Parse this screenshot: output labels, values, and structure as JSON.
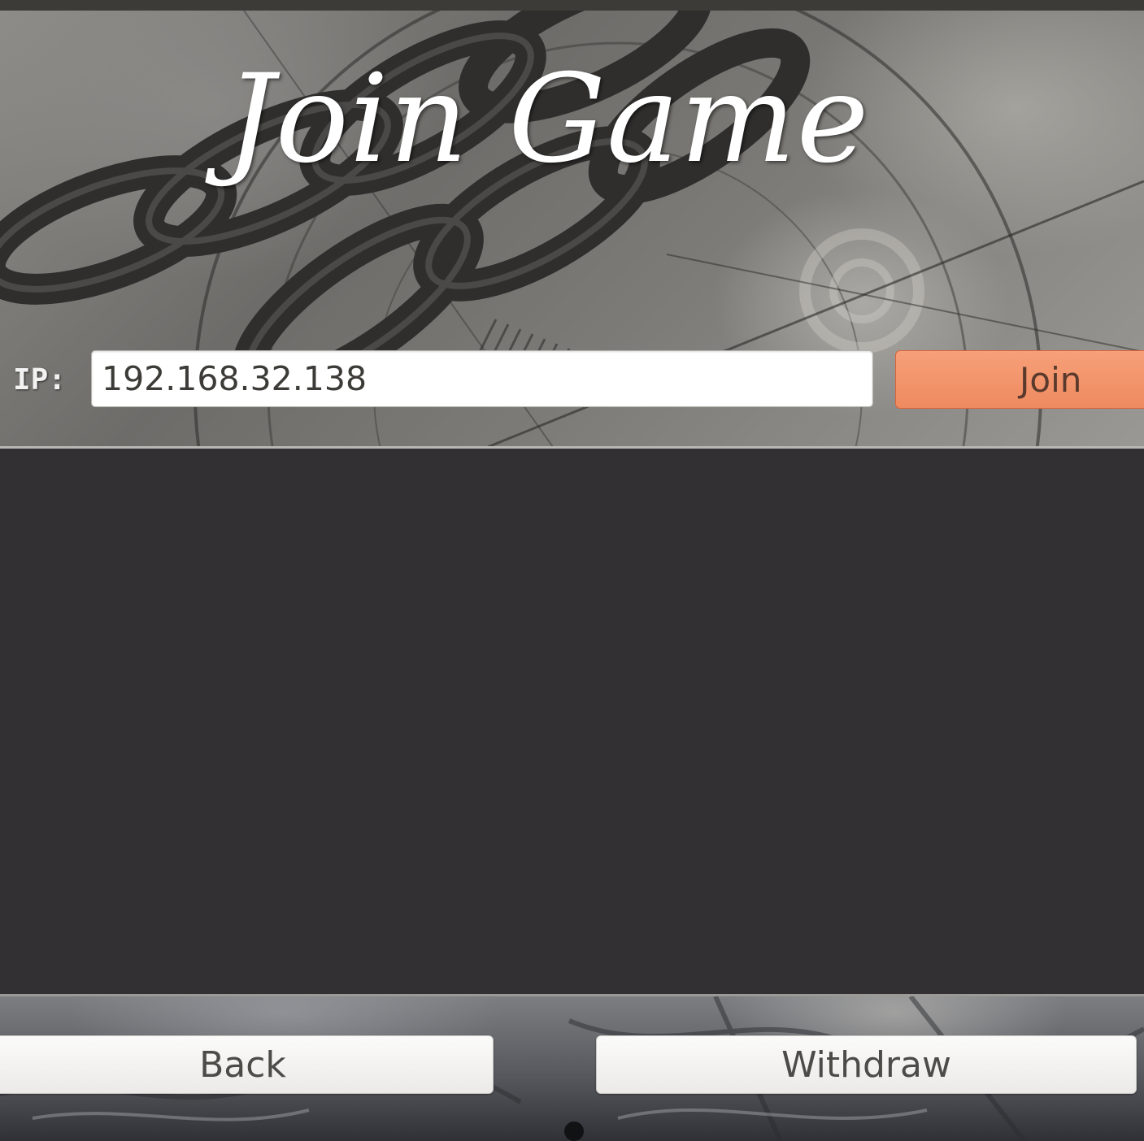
{
  "header": {
    "title": "Join Game"
  },
  "connection": {
    "ip_label": "IP:",
    "ip_value": "192.168.32.138",
    "join_label": "Join"
  },
  "footer": {
    "back_label": "Back",
    "withdraw_label": "Withdraw"
  },
  "colors": {
    "content_background": "#323033",
    "join_button": "#ee8a60",
    "title_text": "#ffffff"
  }
}
